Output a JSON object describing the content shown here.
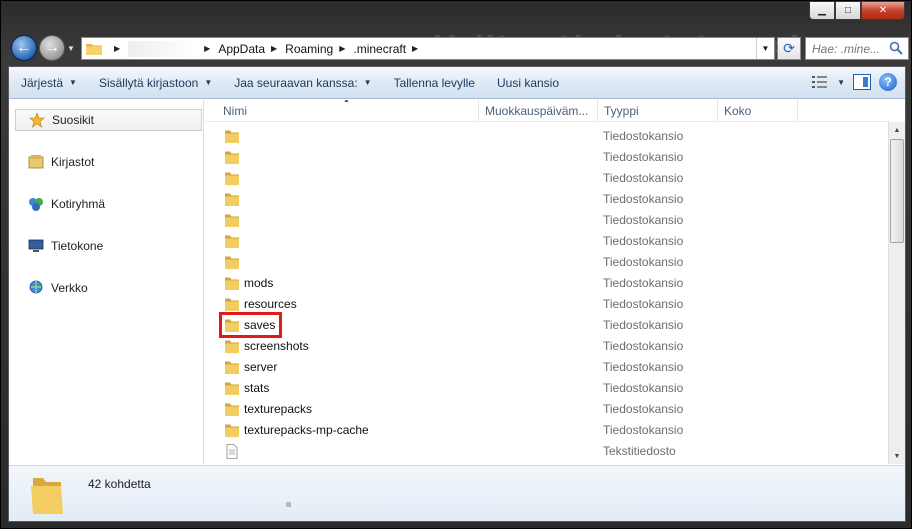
{
  "window": {
    "caption_buttons": {
      "minimize": "▁",
      "maximize": "□",
      "close": "✕"
    },
    "background_text": "Valitse tiedostotyyppi"
  },
  "navigation": {
    "breadcrumbs": [
      "AppData",
      "Roaming",
      ".minecraft"
    ],
    "search_placeholder": "Hae: .mine...",
    "refresh_icon": "⟳"
  },
  "toolbar": {
    "items": [
      {
        "label": "Järjestä",
        "has_caret": true
      },
      {
        "label": "Sisällytä kirjastoon",
        "has_caret": true
      },
      {
        "label": "Jaa seuraavan kanssa:",
        "has_caret": true
      },
      {
        "label": "Tallenna levylle",
        "has_caret": false
      },
      {
        "label": "Uusi kansio",
        "has_caret": false
      }
    ],
    "help_label": "?"
  },
  "sidebar": {
    "items": [
      {
        "label": "Suosikit",
        "icon": "star-icon"
      },
      {
        "label": "Kirjastot",
        "icon": "libraries-icon"
      },
      {
        "label": "Kotiryhmä",
        "icon": "homegroup-icon"
      },
      {
        "label": "Tietokone",
        "icon": "computer-icon"
      },
      {
        "label": "Verkko",
        "icon": "network-icon"
      }
    ]
  },
  "columns": {
    "name": "Nimi",
    "modified": "Muokkauspäiväm...",
    "type": "Tyyppi",
    "size": "Koko"
  },
  "files": [
    {
      "name": "",
      "type": "Tiedostokansio",
      "kind": "folder"
    },
    {
      "name": "",
      "type": "Tiedostokansio",
      "kind": "folder"
    },
    {
      "name": "",
      "type": "Tiedostokansio",
      "kind": "folder"
    },
    {
      "name": "",
      "type": "Tiedostokansio",
      "kind": "folder"
    },
    {
      "name": "",
      "type": "Tiedostokansio",
      "kind": "folder"
    },
    {
      "name": "",
      "type": "Tiedostokansio",
      "kind": "folder"
    },
    {
      "name": "",
      "type": "Tiedostokansio",
      "kind": "folder"
    },
    {
      "name": "mods",
      "type": "Tiedostokansio",
      "kind": "folder"
    },
    {
      "name": "resources",
      "type": "Tiedostokansio",
      "kind": "folder"
    },
    {
      "name": "saves",
      "type": "Tiedostokansio",
      "kind": "folder",
      "highlighted": true
    },
    {
      "name": "screenshots",
      "type": "Tiedostokansio",
      "kind": "folder"
    },
    {
      "name": "server",
      "type": "Tiedostokansio",
      "kind": "folder"
    },
    {
      "name": "stats",
      "type": "Tiedostokansio",
      "kind": "folder"
    },
    {
      "name": "texturepacks",
      "type": "Tiedostokansio",
      "kind": "folder"
    },
    {
      "name": "texturepacks-mp-cache",
      "type": "Tiedostokansio",
      "kind": "folder"
    },
    {
      "name": "",
      "type": "Tekstitiedosto",
      "kind": "text"
    }
  ],
  "details": {
    "item_count": "42 kohdetta"
  },
  "colors": {
    "highlight_border": "#e11b1b",
    "folder": "#f0c24b",
    "toolbar_text": "#1e395b"
  }
}
